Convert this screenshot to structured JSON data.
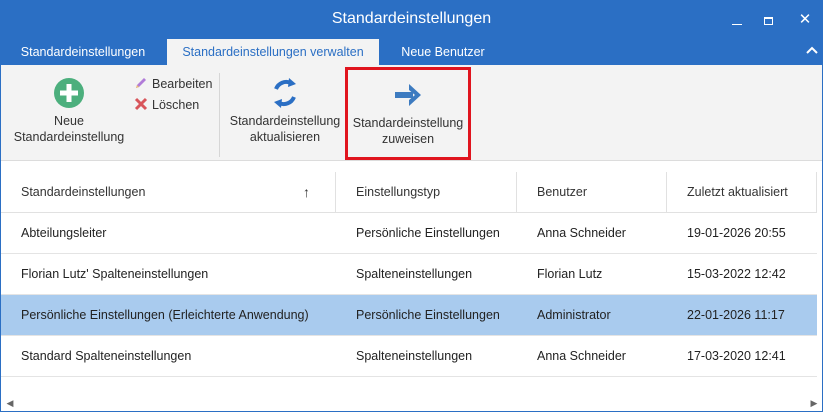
{
  "window": {
    "title": "Standardeinstellungen",
    "controls": {
      "minimize": "minimize",
      "maximize": "maximize",
      "close": "✕"
    }
  },
  "tabs": [
    {
      "label": "Standardeinstellungen"
    },
    {
      "label": "Standardeinstellungen verwalten",
      "active": true
    },
    {
      "label": "Neue Benutzer"
    }
  ],
  "ribbon": {
    "new_label_1": "Neue",
    "new_label_2": "Standardeinstellung",
    "edit_label": "Bearbeiten",
    "delete_label": "Löschen",
    "refresh_label_1": "Standardeinstellung",
    "refresh_label_2": "aktualisieren",
    "assign_label_1": "Standardeinstellung",
    "assign_label_2": "zuweisen"
  },
  "colors": {
    "accent": "#2b6fc4",
    "selected_row": "#a9cbee",
    "highlight_border": "#e0141e",
    "add_icon": "#4caf7d",
    "refresh_icon": "#2b6fc4",
    "arrow_icon": "#3d7bc0",
    "delete_icon": "#d8555a"
  },
  "table": {
    "columns": [
      "Standardeinstellungen",
      "Einstellungstyp",
      "Benutzer",
      "Zuletzt aktualisiert"
    ],
    "sort_indicator": "↑",
    "rows": [
      {
        "name": "Abteilungsleiter",
        "type": "Persönliche Einstellungen",
        "user": "Anna Schneider",
        "updated": "19-01-2026 20:55",
        "selected": false
      },
      {
        "name": "Florian Lutz' Spalteneinstellungen",
        "type": "Spalteneinstellungen",
        "user": "Florian Lutz",
        "updated": "15-03-2022 12:42",
        "selected": false
      },
      {
        "name": "Persönliche Einstellungen (Erleichterte Anwendung)",
        "type": "Persönliche Einstellungen",
        "user": "Administrator",
        "updated": "22-01-2026 11:17",
        "selected": true
      },
      {
        "name": "Standard Spalteneinstellungen",
        "type": "Spalteneinstellungen",
        "user": "Anna Schneider",
        "updated": "17-03-2020 12:41",
        "selected": false
      }
    ]
  }
}
